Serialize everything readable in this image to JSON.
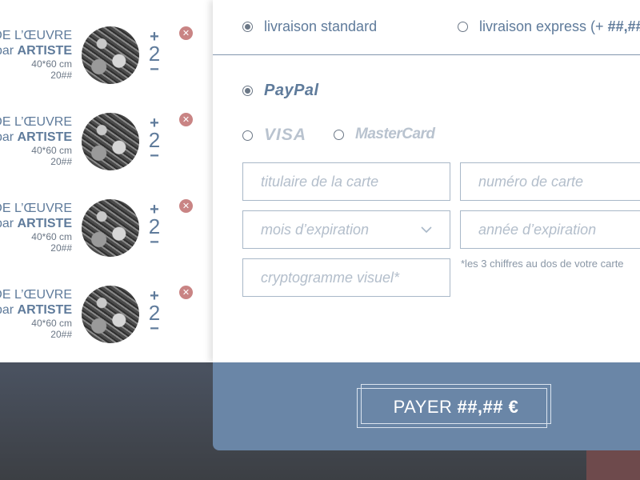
{
  "cart": {
    "items": [
      {
        "title": "DE L’ŒUVRE",
        "by": "par",
        "artist": "ARTISTE",
        "size": "40*60 cm",
        "year": "20##",
        "quantity": "2",
        "plus": "+",
        "minus": "−",
        "remove": "✕"
      },
      {
        "title": "DE L’ŒUVRE",
        "by": "par",
        "artist": "ARTISTE",
        "size": "40*60 cm",
        "year": "20##",
        "quantity": "2",
        "plus": "+",
        "minus": "−",
        "remove": "✕"
      },
      {
        "title": "DE L’ŒUVRE",
        "by": "par",
        "artist": "ARTISTE",
        "size": "40*60 cm",
        "year": "20##",
        "quantity": "2",
        "plus": "+",
        "minus": "−",
        "remove": "✕"
      },
      {
        "title": "DE L’ŒUVRE",
        "by": "par",
        "artist": "ARTISTE",
        "size": "40*60 cm",
        "year": "20##",
        "quantity": "2",
        "plus": "+",
        "minus": "−",
        "remove": "✕"
      }
    ]
  },
  "shipping": {
    "standard_label": "livraison standard",
    "express_label": "livraison express (+",
    "express_price": "##,##"
  },
  "payment": {
    "paypal": "PayPal",
    "visa": "VISA",
    "mastercard": "MasterCard",
    "cardholder_placeholder": "titulaire de la carte",
    "card_number_placeholder": "numéro de carte",
    "exp_month_placeholder": "mois d’expiration",
    "exp_year_placeholder": "année d’expiration",
    "cvv_placeholder": "cryptogramme visuel*",
    "cvv_hint": "*les 3 chiffres au dos de votre carte"
  },
  "pay_button": {
    "label": "PAYER",
    "amount": "##,## €"
  },
  "colors": {
    "accent": "#6a86a7",
    "text": "#5f7b9b",
    "remove": "#c98484",
    "border": "#a9b8c8"
  },
  "icons": {
    "remove": "close-icon",
    "select": "chevron-down-icon",
    "thumbnail": "artwork-thumbnail"
  }
}
